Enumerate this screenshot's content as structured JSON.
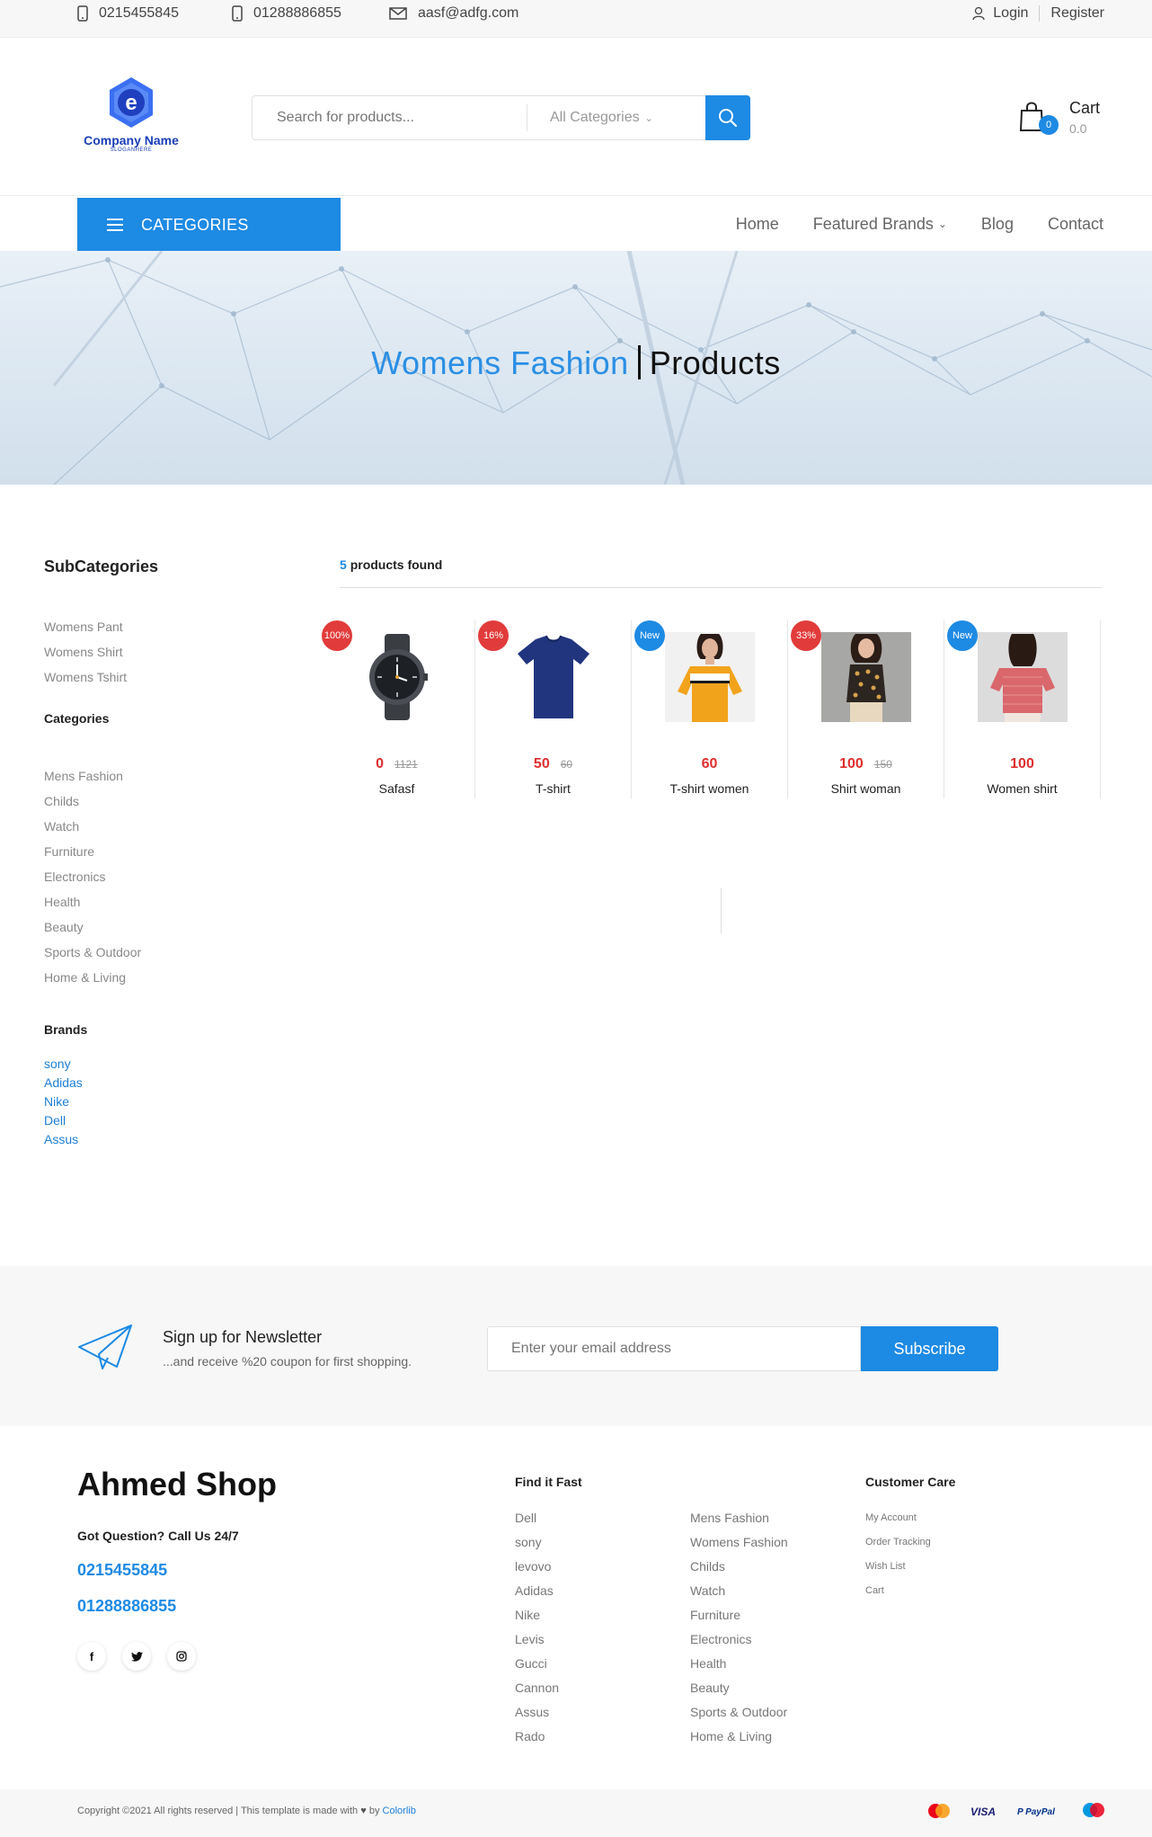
{
  "topbar": {
    "phone1": "0215455845",
    "phone2": "01288886855",
    "email": "aasf@adfg.com",
    "login": "Login",
    "register": "Register"
  },
  "header": {
    "logo_name": "Company Name",
    "logo_slogan": "SLOGANHERE",
    "search_placeholder": "Search for products...",
    "category_select": "All Categories",
    "cart_label": "Cart",
    "cart_count": "0",
    "cart_total": "0.0"
  },
  "nav": {
    "categories_button": "CATEGORIES",
    "links": [
      "Home",
      "Featured Brands",
      "Blog",
      "Contact"
    ]
  },
  "banner": {
    "title_accent": "Womens Fashion",
    "title_main": "Products"
  },
  "sidebar": {
    "subcategories_title": "SubCategories",
    "subcategories": [
      "Womens Pant",
      "Womens Shirt",
      "Womens Tshirt"
    ],
    "categories_title": "Categories",
    "categories": [
      "Mens Fashion",
      "Childs",
      "Watch",
      "Furniture",
      "Electronics",
      "Health",
      "Beauty",
      "Sports & Outdoor",
      "Home & Living"
    ],
    "brands_title": "Brands",
    "brands": [
      "sony",
      "Adidas",
      "Nike",
      "Dell",
      "Assus"
    ]
  },
  "results": {
    "count": "5",
    "label": "products found"
  },
  "products": [
    {
      "name": "Safasf",
      "price": "0",
      "old_price": "1121",
      "tag": "100%",
      "tag_type": "sale",
      "image": "watch"
    },
    {
      "name": "T-shirt",
      "price": "50",
      "old_price": "60",
      "tag": "16%",
      "tag_type": "sale",
      "image": "blue-tshirt"
    },
    {
      "name": "T-shirt women",
      "price": "60",
      "old_price": "",
      "tag": "New",
      "tag_type": "new",
      "image": "woman-yellow-top"
    },
    {
      "name": "Shirt woman",
      "price": "100",
      "old_price": "150",
      "tag": "33%",
      "tag_type": "sale",
      "image": "woman-patterned-shirt"
    },
    {
      "name": "Women shirt",
      "price": "100",
      "old_price": "",
      "tag": "New",
      "tag_type": "new",
      "image": "woman-pink-shirt"
    }
  ],
  "newsletter": {
    "title": "Sign up for Newsletter",
    "subtitle": "...and receive %20 coupon for first shopping.",
    "placeholder": "Enter your email address",
    "button": "Subscribe"
  },
  "footer": {
    "brand": "Ahmed Shop",
    "question": "Got Question? Call Us 24/7",
    "phone1": "0215455845",
    "phone2": "01288886855",
    "find_title": "Find it Fast",
    "find_col1": [
      "Dell",
      "sony",
      "levovo",
      "Adidas",
      "Nike",
      "Levis",
      "Gucci",
      "Cannon",
      "Assus",
      "Rado"
    ],
    "find_col2": [
      "Mens Fashion",
      "Womens Fashion",
      "Childs",
      "Watch",
      "Furniture",
      "Electronics",
      "Health",
      "Beauty",
      "Sports & Outdoor",
      "Home & Living"
    ],
    "care_title": "Customer Care",
    "care_links": [
      "My Account",
      "Order Tracking",
      "Wish List",
      "Cart"
    ],
    "copyright": "Copyright ©2021 All rights reserved | This template is made with",
    "copyright_by": "by",
    "copyright_link": "Colorlib",
    "payments": [
      "mastercard-icon",
      "visa-icon",
      "paypal-icon",
      "maestro-icon"
    ]
  },
  "colors": {
    "accent": "#1d8ae4",
    "sale": "#e23b3b",
    "price": "#e02e2e"
  }
}
